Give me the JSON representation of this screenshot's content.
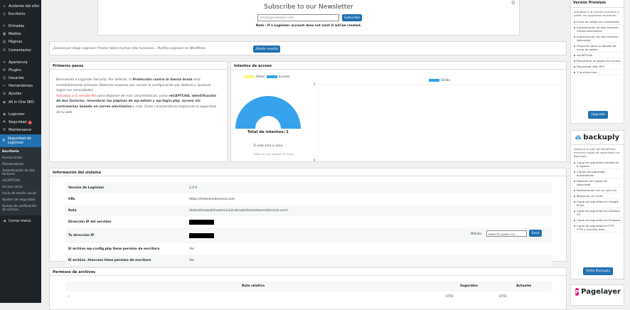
{
  "sidebar": {
    "items": [
      {
        "icon": "⌂",
        "label": "Acidente del sitio"
      },
      {
        "icon": "◷",
        "label": "Escritorio"
      },
      {
        "icon": "✎",
        "label": "Entradas"
      },
      {
        "icon": "▣",
        "label": "Medios"
      },
      {
        "icon": "▤",
        "label": "Páginas"
      },
      {
        "icon": "✉",
        "label": "Comentarios"
      },
      {
        "icon": "✦",
        "label": "Apariencia"
      },
      {
        "icon": "⚙",
        "label": "Plugins"
      },
      {
        "icon": "☺",
        "label": "Usuarios"
      },
      {
        "icon": "✂",
        "label": "Herramientas"
      },
      {
        "icon": "⊞",
        "label": "Ajustes"
      },
      {
        "icon": "◉",
        "label": "All in One SEO"
      },
      {
        "icon": "◆",
        "label": "Loginizer"
      }
    ],
    "security": {
      "icon": "⚑",
      "label": "Seguridad",
      "badge": "1"
    },
    "maintenance": {
      "icon": "⚒",
      "label": "Maintenance"
    },
    "active": {
      "icon": "⛨",
      "label": "Seguridad de Loginizer"
    },
    "submenu": [
      "Escritorio",
      "Fuerza bruta",
      "PasswordLess",
      "Autenticación de dos factores",
      "reCAPTCHA",
      "Acceso único",
      "Inicio de sesión social",
      "Ajustes de seguridad",
      "Sumas de verificación de archivo"
    ],
    "collapse": {
      "icon": "◀",
      "label": "Cerrar menú"
    }
  },
  "newsletter": {
    "title": "Subscribe to our Newsletter",
    "placeholder": "email@example.com",
    "button": "Subscribe",
    "note": "Note : If a Loginizer account does not exist it will be created."
  },
  "notice": {
    "text": "¡Gracias por elegir Loginizer! Pronto habrá muchas más funciones... Purifica Loginizer en WordPress",
    "button": "Añadir reseña"
  },
  "primeros": {
    "title": "Primeros pasos",
    "p1_a": "Bienvenido a Loginizer Security. Por defecto, la ",
    "p1_b": "Protección contra la fuerza bruta",
    "p1_c": " está inmediatamente activada. Deberías empezar por revisar la configuración por defecto y ajustarla según tus necesidades.",
    "p2_red": "Actualiza a la versión Pro",
    "p2_a": " para disponer de más características, como ",
    "p2_b": "reCAPTCHA, identificación de dos factores, renombrar las páginas de wp-admin y wp-login.php, acceso sin contraseñas basado en correo electrónico",
    "p2_c": " y más. Estas características mejorarán la seguridad de tu web."
  },
  "intentos": {
    "title": "Intentos de acceso",
    "legend_failed": "Failed",
    "legend_success": "Success",
    "legend_right": "Fallido",
    "total_label": "Total de intentos: 1",
    "safe": "Tu web está a salvo",
    "period": "Datos de las últimas 24 horas",
    "y_top": "1",
    "y_bottom": "0",
    "colors": {
      "failed": "#fbf57f",
      "success": "#36a2eb"
    }
  },
  "sistema": {
    "title": "Información del sistema",
    "rows": [
      {
        "key": "Versión de Loginizer",
        "value": "2.0.0"
      },
      {
        "key": "URL",
        "value": "https://esteesmidominio.com"
      },
      {
        "key": "Ruta",
        "value": "/data/sites/web/hudominio2cat/subsites/esteesmidominio.com/"
      },
      {
        "key": "Dirección IP del servidor",
        "value": ""
      },
      {
        "key": "Tu dirección IP",
        "value": ""
      },
      {
        "key": "El archivo wp-config.php tiene permiso de escritura",
        "value": "Yes"
      },
      {
        "key": "El archivo .htaccess tiene permiso de escritura",
        "value": "Yes"
      }
    ],
    "method_label": "Método",
    "method_value": "REMOTE_ADDR 213 ...",
    "save": "Save"
  },
  "permisos": {
    "title": "Permisos de archivos",
    "cols": [
      "Ruta relativa",
      "Sugeridos",
      "Actuales"
    ],
    "row": [
      "/",
      "0755",
      "0755"
    ]
  },
  "premium": {
    "title": "Versión Premium",
    "desc": "Actualiza a la versión premium y obtén las siguientes funciones :",
    "items": [
      "Inicio de sesión sin contraseña",
      "Autenticación de dos factores - Correo electrónico",
      "Autenticación de dos factores - Aplicación",
      "Pregunta sobre el desafío de inicio de sesión",
      "reCAPTCHA",
      "Renombrar la página de acceso",
      "Desactivar XML-RPC",
      "Y muchas más..."
    ],
    "button": "Upgrade"
  },
  "backuply": {
    "logo": "backuply",
    "desc": "Asegura tu sitio de WordPress creando copias de seguridad con Backuply",
    "items": [
      "Copia de seguridad remota en 6 lugares",
      "Copias de seguridad automáticas",
      "Rotación de copias de seguridad",
      "Restauración con un solo clic",
      "Migración sin errés",
      "Copia de seguridad en Google Drive",
      "Copia de seguridad en Amazon S3",
      "Copia de seguridad en Dropbox",
      "Copia de seguridad en FTP, FTPS y muchos más..."
    ],
    "button": "Visita Backuply"
  },
  "pagelayer": {
    "logo": "Pagelayer",
    "logo_letter": "P"
  }
}
